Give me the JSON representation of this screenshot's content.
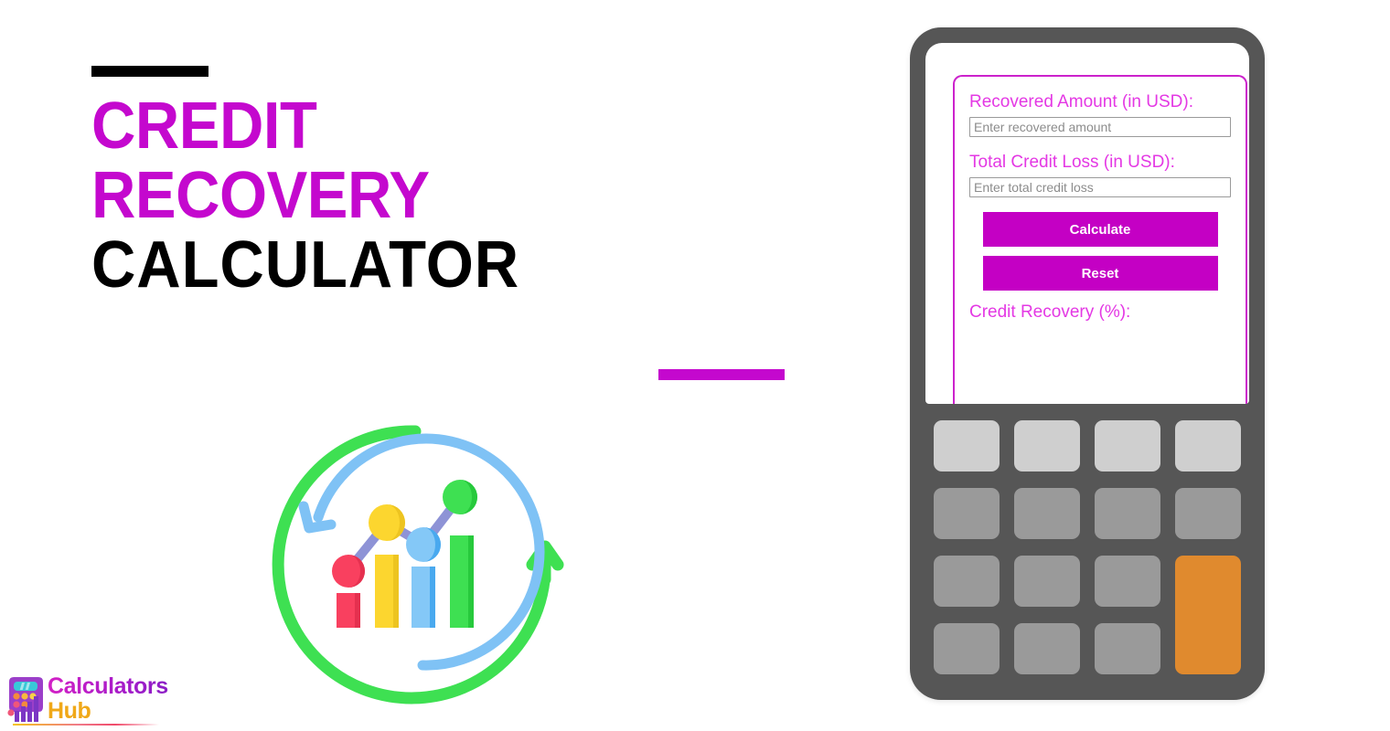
{
  "page": {
    "background": "#ffffff",
    "accent_magenta": "#c408ce",
    "accent_black": "#000000"
  },
  "title": {
    "line1": "CREDIT",
    "line2": "RECOVERY",
    "line3": "CALCULATOR",
    "line1_color": "#c408ce",
    "line2_color": "#c408ce",
    "line3_color": "#000000",
    "top_rule_color": "#000000",
    "bottom_rule_color": "#c408ce"
  },
  "illustration": {
    "name": "credit-recovery-chart-illustration",
    "outer_arc_color": "#3ee052",
    "inner_arc_color": "#7fc2f5",
    "line_color": "#8e93d6",
    "bars": [
      {
        "label": "bar-1",
        "color": "#f9405f",
        "shade": "#e5304f",
        "height_pct": 26
      },
      {
        "label": "bar-2",
        "color": "#fcd62f",
        "shade": "#edc420",
        "height_pct": 60
      },
      {
        "label": "bar-3",
        "color": "#84c8f7",
        "shade": "#49a9ef",
        "height_pct": 44
      },
      {
        "label": "bar-4",
        "color": "#3ee052",
        "shade": "#27c93c",
        "height_pct": 74
      }
    ],
    "dots": [
      {
        "label": "dot-1",
        "color": "#f9405f",
        "shade": "#e5304f"
      },
      {
        "label": "dot-2",
        "color": "#fcd62f",
        "shade": "#edc420"
      },
      {
        "label": "dot-3",
        "color": "#84c8f7",
        "shade": "#49a9ef"
      },
      {
        "label": "dot-4",
        "color": "#3ee052",
        "shade": "#27c93c"
      }
    ]
  },
  "logo": {
    "word1": "Calculators",
    "word2": "Hub",
    "word1_color": "#c21fc9",
    "word2_color": "#f0a818",
    "icon_name": "calculator-chart-logo-icon"
  },
  "calculator": {
    "body_color": "#565656",
    "screen_color": "#ffffff",
    "panel_border_color": "#cc22cc",
    "form": {
      "field1": {
        "label": "Recovered Amount (in USD):",
        "placeholder": "Enter recovered amount",
        "value": ""
      },
      "field2": {
        "label": "Total Credit Loss (in USD):",
        "placeholder": "Enter total credit loss",
        "value": ""
      },
      "calculate_label": "Calculate",
      "reset_label": "Reset",
      "result_label": "Credit Recovery (%):",
      "result_value": "",
      "button_color": "#c400c4",
      "label_color": "#e438e4"
    },
    "keypad": {
      "rows": 4,
      "cols": 4,
      "light_key_color": "#cfcfcf",
      "mid_key_color": "#9a9a9a",
      "accent_key_color": "#e08a2e"
    }
  }
}
